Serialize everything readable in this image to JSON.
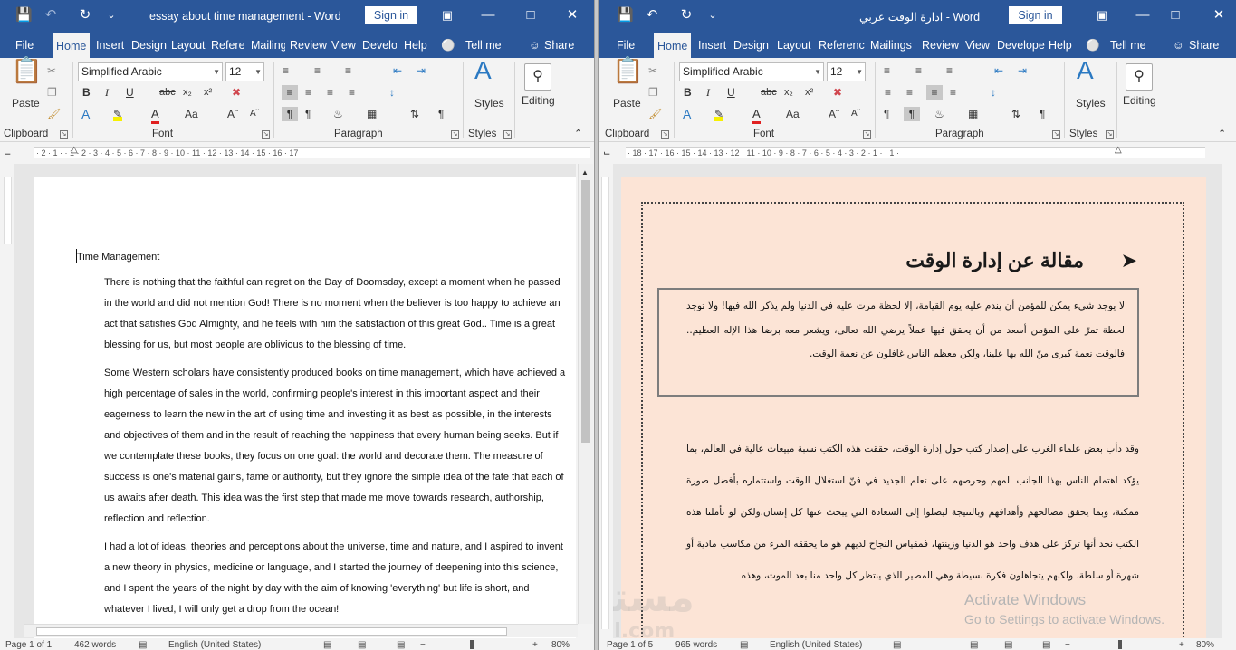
{
  "left_window": {
    "title": "essay about time management  -  Word",
    "signin": "Sign in",
    "tabs": [
      "File",
      "Home",
      "Insert",
      "Design",
      "Layout",
      "Referen",
      "Mailing",
      "Review",
      "View",
      "Develo",
      "Help"
    ],
    "tell_me": "Tell me",
    "share": "Share",
    "font_name": "Simplified Arabic",
    "font_size": "12",
    "groups": {
      "clipboard": "Clipboard",
      "font": "Font",
      "paragraph": "Paragraph",
      "styles": "Styles"
    },
    "paste": "Paste",
    "styles_btn": "Styles",
    "editing_btn": "Editing",
    "ruler_ticks": "· 2 · 1 · · 1 · 2 · 3 · 4 · 5 · 6 · 7 · 8 · 9 · 10 · 11 · 12 · 13 · 14 · 15 · 16 · 17",
    "doc": {
      "title": "Time Management",
      "paragraphs": [
        "There is nothing that the faithful can regret on the Day of Doomsday, except a moment when he passed in the world and did not mention God! There is no moment when the believer is too happy to achieve an act that satisfies God Almighty, and he feels with him the satisfaction of this great God.. Time is a great blessing for us, but most people are oblivious to the blessing of time.",
        "Some Western scholars have consistently produced books on time management, which have achieved a high percentage of sales in the world, confirming people's interest in this important aspect and their eagerness to learn the new in the art of using time and investing it as best as possible, in the interests and objectives of them and in the result of reaching the happiness that every human being seeks. But if we contemplate these books, they focus on one goal: the world and decorate them. The measure of success is one's material gains, fame or authority, but they ignore the simple idea of the fate that each of us awaits after death. This idea was the first step that made me move towards research, authorship, reflection and reflection.",
        "I had a lot of ideas, theories and perceptions about the universe, time and nature, and I aspired to invent a new theory in physics, medicine or language, and I started the journey of deepening into this science, and I spent the years of the night by day with the aim of knowing 'everything' but life is short, and whatever I lived, I will only get a drop from the ocean!"
      ]
    },
    "status": {
      "page": "Page 1 of 1",
      "words": "462 words",
      "lang": "English (United States)",
      "zoom": "80%"
    }
  },
  "right_window": {
    "title": "ادارة الوقت عربي  -  Word",
    "signin": "Sign in",
    "tabs": [
      "File",
      "Home",
      "Insert",
      "Design",
      "Layout",
      "Referenc",
      "Mailings",
      "Review",
      "View",
      "Develope",
      "Help"
    ],
    "tell_me": "Tell me",
    "share": "Share",
    "font_name": "Simplified Arabic",
    "font_size": "12",
    "groups": {
      "clipboard": "Clipboard",
      "font": "Font",
      "paragraph": "Paragraph",
      "styles": "Styles"
    },
    "paste": "Paste",
    "styles_btn": "Styles",
    "editing_btn": "Editing",
    "ruler_ticks": "· 18 · 17 · 16 · 15 · 14 · 13 · 12 · 11 · 10 · 9 · 8 · 7 · 6 · 5 · 4 · 3 · 2 · 1 · · 1 ·",
    "doc": {
      "heading": "مقالة عن إدارة الوقت",
      "box_text": "لا يوجد شيء يمكن للمؤمن أن يندم عليه يوم القيامة، إلا لحظة مرت عليه في الدنيا ولم يذكر الله فيها! ولا توجد لحظة تمرّ على المؤمن أسعد من أن يحقق فيها عملاً يرضي الله تعالى، ويشعر معه برضا هذا الإله العظيم.. فالوقت نعمة كبرى منّ الله بها علينا، ولكن معظم الناس غافلون عن نعمة الوقت.",
      "body_text": "وقد دأب بعض علماء الغرب على إصدار كتب حول إدارة الوقت، حققت هذه الكتب نسبة مبيعات عالية في العالم، بما يؤكد اهتمام الناس بهذا الجانب المهم وحرصهم على تعلم الجديد في فنّ استغلال الوقت واستثماره بأفضل صورة ممكنة، وبما يحقق مصالحهم وأهدافهم وبالنتيجة ليصلوا إلى السعادة التي يبحث عنها كل إنسان.ولكن لو تأملنا هذه الكتب نجد أنها تركز على هدف واحد هو الدنيا وزينتها، فمقياس النجاح لديهم هو ما يحققه المرء من مكاسب مادية أو شهرة أو سلطة، ولكنهم يتجاهلون فكرة بسيطة وهي المصير الذي ينتظر كل واحد منا بعد الموت، وهذه"
    },
    "status": {
      "page": "Page 1 of 5",
      "words": "965 words",
      "lang": "English (United States)",
      "zoom": "80%"
    },
    "activate_title": "Activate Windows",
    "activate_sub": "Go to Settings to activate Windows.",
    "watermark_logo": "مستقل",
    "watermark_url": "mostaql.com"
  },
  "colors": {
    "word_blue": "#2b579a",
    "ribbon_bg": "#f3f3f3",
    "arabic_page_bg": "#fce4d6"
  }
}
